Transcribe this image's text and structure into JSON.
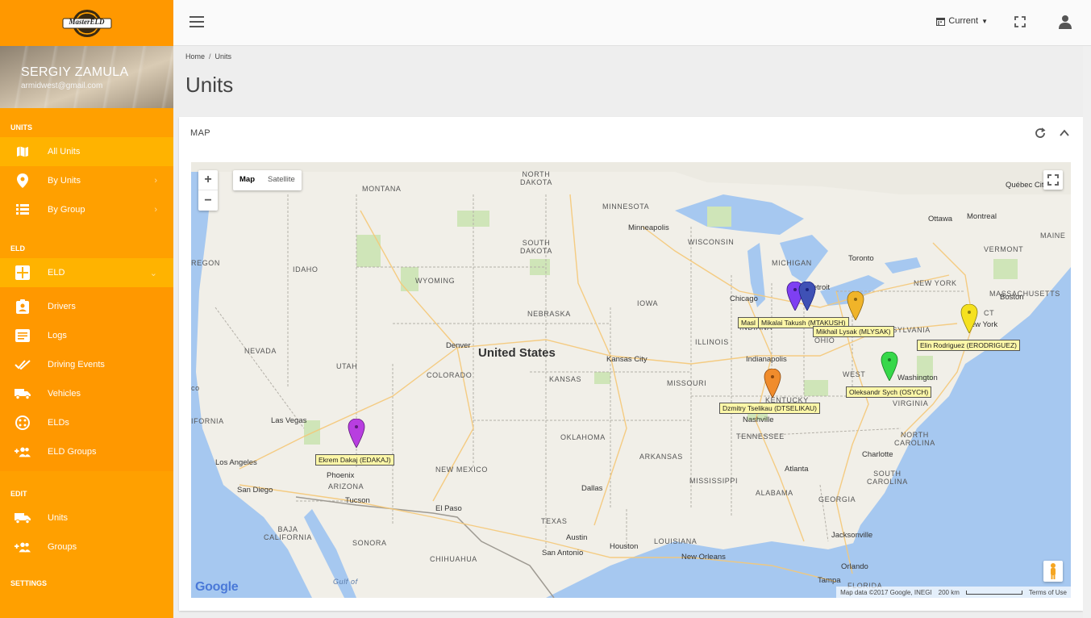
{
  "app": {
    "logo_text": "MasterELD"
  },
  "user": {
    "name": "SERGIY ZAMULA",
    "email": "armidwest@gmail.com"
  },
  "sidebar": {
    "units_section": "UNITS",
    "units_items": [
      {
        "label": "All Units",
        "icon": "map-icon"
      },
      {
        "label": "By Units",
        "icon": "pin-icon"
      },
      {
        "label": "By Group",
        "icon": "list-icon"
      }
    ],
    "eld_section": "ELD",
    "eld_parent": {
      "label": "ELD",
      "icon": "eld-icon"
    },
    "eld_items": [
      {
        "label": "Drivers",
        "icon": "badge-icon"
      },
      {
        "label": "Logs",
        "icon": "log-icon"
      },
      {
        "label": "Driving Events",
        "icon": "check-double-icon"
      },
      {
        "label": "Vehicles",
        "icon": "truck-icon"
      },
      {
        "label": "ELDs",
        "icon": "device-icon"
      },
      {
        "label": "ELD Groups",
        "icon": "group-add-icon"
      }
    ],
    "edit_section": "EDIT",
    "edit_items": [
      {
        "label": "Units",
        "icon": "truck-icon"
      },
      {
        "label": "Groups",
        "icon": "group-add-icon"
      }
    ],
    "settings_section": "SETTINGS"
  },
  "topbar": {
    "current_label": "Current"
  },
  "breadcrumb": {
    "home": "Home",
    "sep": "/",
    "current": "Units"
  },
  "page_title": "Units",
  "card": {
    "title": "MAP"
  },
  "map": {
    "type_map": "Map",
    "type_satellite": "Satellite",
    "zoom_in": "+",
    "zoom_out": "−",
    "attribution": "Map data ©2017 Google, INEGI",
    "scale": "200 km",
    "terms": "Terms of Use",
    "google": "Google",
    "country_label": "United States",
    "regions": {
      "north_dakota": "NORTH\nDAKOTA",
      "montana": "MONTANA",
      "minnesota": "MINNESOTA",
      "south_dakota": "SOUTH\nDAKOTA",
      "wisconsin": "WISCONSIN",
      "michigan": "MICHIGAN",
      "idaho": "IDAHO",
      "wyoming": "WYOMING",
      "nebraska": "NEBRASKA",
      "iowa": "IOWA",
      "nevada": "NEVADA",
      "utah": "UTAH",
      "colorado": "COLORADO",
      "kansas": "KANSAS",
      "missouri": "MISSOURI",
      "illinois": "ILLINOIS",
      "indiana": "INDIANA",
      "ohio": "OHIO",
      "kentucky": "KENTUCKY",
      "tennessee": "TENNESSEE",
      "west_virginia": "WEST",
      "virginia": "VIRGINIA",
      "north_carolina": "NORTH\nCAROLINA",
      "south_carolina": "SOUTH\nCAROLINA",
      "oklahoma": "OKLAHOMA",
      "arkansas": "ARKANSAS",
      "new_mexico": "NEW MEXICO",
      "arizona": "ARIZONA",
      "texas": "TEXAS",
      "louisiana": "LOUISIANA",
      "mississippi": "MISSISSIPPI",
      "alabama": "ALABAMA",
      "georgia": "GEORGIA",
      "florida": "FLORIDA",
      "new_york": "NEW YORK",
      "pennsylvania": "PENNSYLVANIA",
      "vermont": "VERMONT",
      "maine": "MAINE",
      "massachusetts": "MASSACHUSETTS",
      "ct": "CT",
      "oregon": "REGON",
      "california": "IFORNIA",
      "baja": "BAJA\nCALIFORNIA",
      "sonora": "SONORA",
      "chihuahua": "CHIHUAHUA",
      "co": "co",
      "gulf": "Gulf of"
    },
    "cities": {
      "minneapolis": "Minneapolis",
      "chicago": "Chicago",
      "detroit": "Detroit",
      "toronto": "Toronto",
      "ottawa": "Ottawa",
      "montreal": "Montreal",
      "quebec": "Québec City",
      "new_york": "New York",
      "washington": "Washington",
      "denver": "Denver",
      "kansas_city": "Kansas City",
      "indianapolis": "Indianapolis",
      "nashville": "Nashville",
      "atlanta": "Atlanta",
      "charlotte": "Charlotte",
      "las_vegas": "Las Vegas",
      "los_angeles": "Los Angeles",
      "san_diego": "San Diego",
      "phoenix": "Phoenix",
      "tucson": "Tucson",
      "el_paso": "El Paso",
      "dallas": "Dallas",
      "austin": "Austin",
      "houston": "Houston",
      "san_antonio": "San Antonio",
      "new_orleans": "New Orleans",
      "jacksonville": "Jacksonville",
      "tampa": "Tampa",
      "orlando": "Orlando",
      "boston": "Boston"
    },
    "units": [
      {
        "label": "Mikalai Takush (MTAKUSH)",
        "color": "#3f51b5"
      },
      {
        "label": "Masl",
        "color": "#7e3ff2"
      },
      {
        "label": "Mikhail Lysak (MLYSAK)",
        "color": "#f0b429"
      },
      {
        "label": "Elin Rodriguez (ERODRIGUEZ)",
        "color": "#f5e11f"
      },
      {
        "label": "Oleksandr Sych (OSYCH)",
        "color": "#37d84a"
      },
      {
        "label": "Dzmitry Tselikau (DTSELIKAU)",
        "color": "#f08c2c"
      },
      {
        "label": "Ekrem Dakaj (EDAKAJ)",
        "color": "#b83ee0"
      }
    ]
  }
}
